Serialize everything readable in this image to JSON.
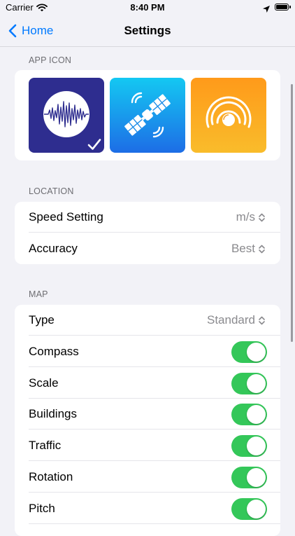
{
  "status_bar": {
    "carrier": "Carrier",
    "time": "8:40 PM",
    "icons": [
      "wifi-icon",
      "location-arrow-icon",
      "battery-icon"
    ]
  },
  "nav": {
    "back_label": "Home",
    "title": "Settings"
  },
  "app_icon_section": {
    "header": "APP ICON",
    "options": [
      {
        "name": "waveform-icon",
        "selected": true
      },
      {
        "name": "satellite-icon",
        "selected": false
      },
      {
        "name": "signal-target-icon",
        "selected": false
      }
    ]
  },
  "location_section": {
    "header": "LOCATION",
    "rows": [
      {
        "label": "Speed Setting",
        "value": "m/s"
      },
      {
        "label": "Accuracy",
        "value": "Best"
      }
    ]
  },
  "map_section": {
    "header": "MAP",
    "type_row": {
      "label": "Type",
      "value": "Standard"
    },
    "toggles": [
      {
        "label": "Compass",
        "on": true
      },
      {
        "label": "Scale",
        "on": true
      },
      {
        "label": "Buildings",
        "on": true
      },
      {
        "label": "Traffic",
        "on": true
      },
      {
        "label": "Rotation",
        "on": true
      },
      {
        "label": "Pitch",
        "on": true
      }
    ]
  },
  "colors": {
    "accent": "#007aff",
    "toggle_on": "#34c759",
    "background": "#f2f2f7",
    "secondary_text": "#8a8a8e"
  }
}
